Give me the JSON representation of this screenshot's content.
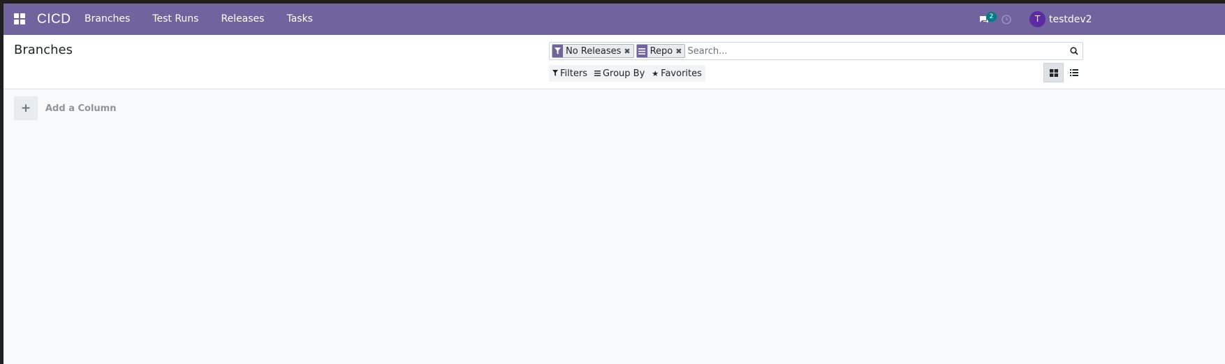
{
  "navbar": {
    "brand": "CICD",
    "menu": [
      {
        "label": "Branches"
      },
      {
        "label": "Test Runs"
      },
      {
        "label": "Releases"
      },
      {
        "label": "Tasks"
      }
    ],
    "chat_badge": "2",
    "avatar_initial": "T",
    "username": "testdev2",
    "icons": [
      "apps-grid-icon",
      "chat-icon",
      "clock-icon"
    ]
  },
  "control_panel": {
    "title": "Branches",
    "facets": [
      {
        "label": "No Releases",
        "icon": "filter-icon"
      },
      {
        "label": "Repo",
        "icon": "group-by-icon"
      }
    ],
    "search_placeholder": "Search...",
    "filters_label": "Filters",
    "group_by_label": "Group By",
    "favorites_label": "Favorites",
    "views": [
      "kanban",
      "list"
    ],
    "active_view": "kanban"
  },
  "kanban": {
    "add_column_label": "Add a Column",
    "add_column_symbol": "+"
  },
  "colors": {
    "navbar": "#71639e",
    "badge": "#017e84",
    "avatar": "#5a2ca0"
  }
}
